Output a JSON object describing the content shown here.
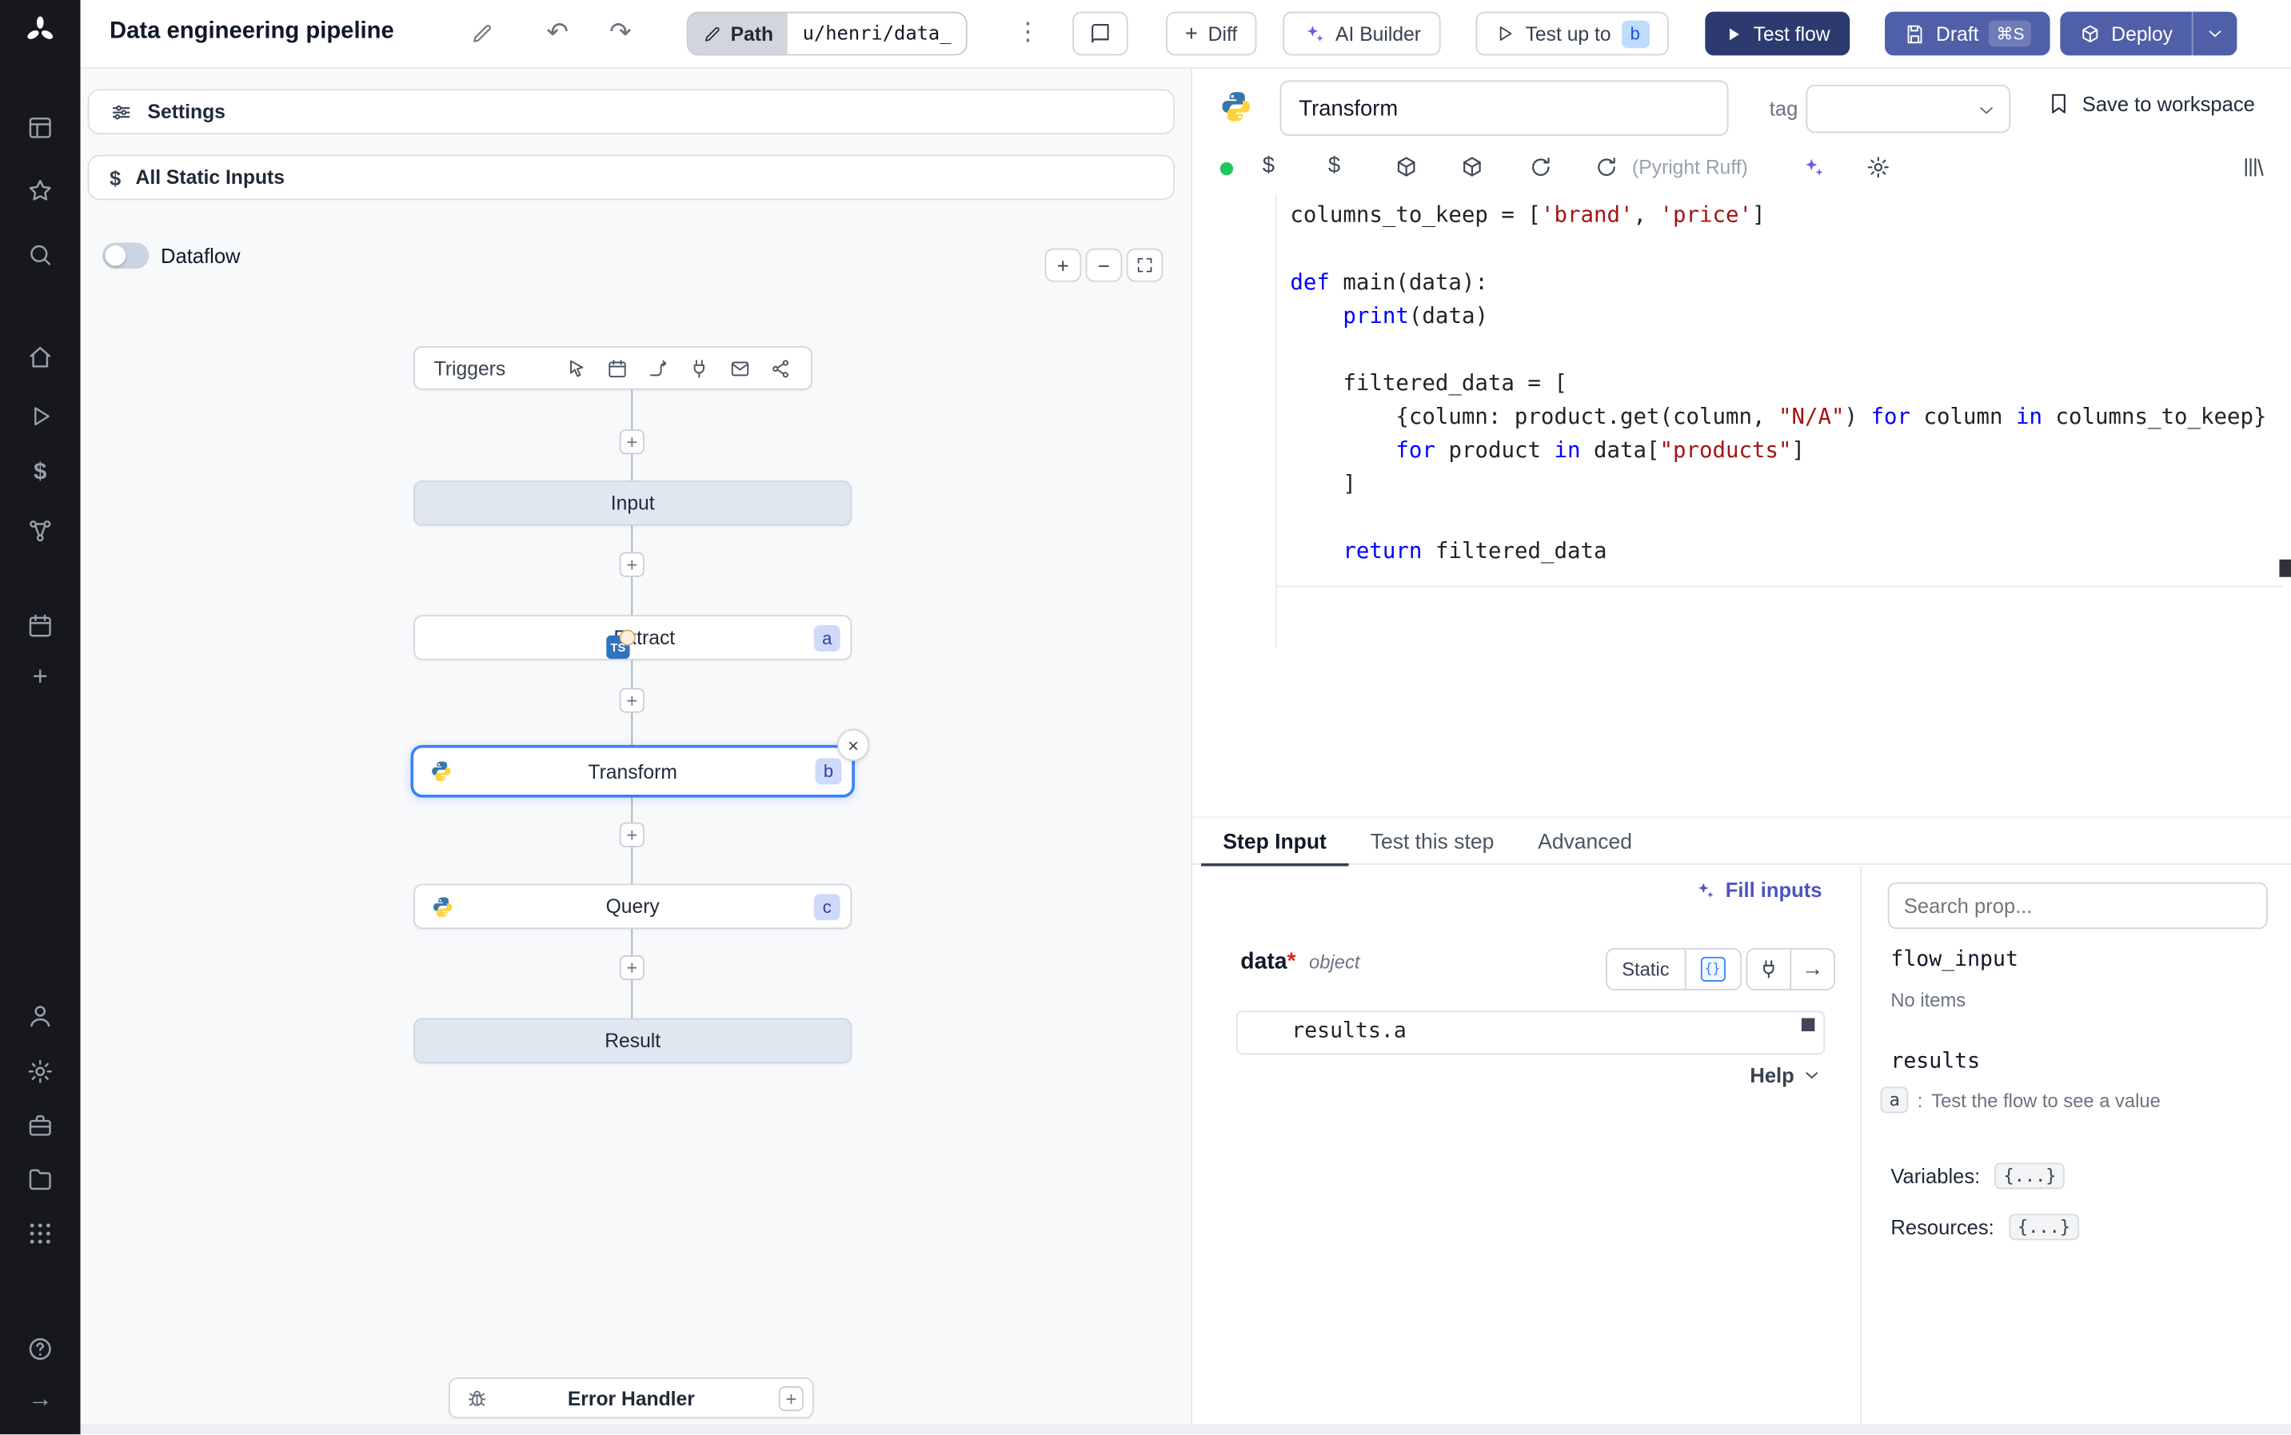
{
  "topbar": {
    "title": "Data engineering pipeline",
    "path_label": "Path",
    "path_value": "u/henri/data_",
    "diff_label": "Diff",
    "ai_builder_label": "AI Builder",
    "test_up_to_label": "Test up to",
    "test_up_to_badge": "b",
    "test_flow_label": "Test flow",
    "draft_label": "Draft",
    "draft_shortcut": "⌘S",
    "deploy_label": "Deploy"
  },
  "icons": {
    "plus": "+",
    "minus": "−",
    "dollar": "$",
    "kebab": "⋮",
    "close": "×",
    "undo": "↶",
    "redo": "↷",
    "arrow_right": "→",
    "braces": "{}",
    "colon": ":"
  },
  "flow": {
    "settings_label": "Settings",
    "static_inputs_label": "All Static Inputs",
    "dataflow_label": "Dataflow",
    "triggers_label": "Triggers",
    "nodes": {
      "input": "Input",
      "extract": {
        "label": "Extract",
        "badge": "a",
        "lang": "TS"
      },
      "transform": {
        "label": "Transform",
        "badge": "b"
      },
      "query": {
        "label": "Query",
        "badge": "c"
      },
      "result": "Result",
      "error_handler": "Error Handler"
    }
  },
  "editor": {
    "step_name": "Transform",
    "tag_label": "tag",
    "save_label": "Save to workspace",
    "diagnostics_label": "(Pyright Ruff)",
    "code_lines": [
      [
        {
          "s": "t",
          "t": "columns_to_keep = ["
        },
        {
          "s": "str",
          "t": "'brand'"
        },
        {
          "s": "t",
          "t": ", "
        },
        {
          "s": "str",
          "t": "'price'"
        },
        {
          "s": "t",
          "t": "]"
        }
      ],
      [],
      [
        {
          "s": "kw",
          "t": "def"
        },
        {
          "s": "t",
          "t": " main(data):"
        }
      ],
      [
        {
          "s": "t",
          "t": "    "
        },
        {
          "s": "kw",
          "t": "print"
        },
        {
          "s": "t",
          "t": "(data)"
        }
      ],
      [],
      [
        {
          "s": "t",
          "t": "    filtered_data = ["
        }
      ],
      [
        {
          "s": "t",
          "t": "        {column: product.get(column, "
        },
        {
          "s": "str",
          "t": "\"N/A\""
        },
        {
          "s": "t",
          "t": ") "
        },
        {
          "s": "kw",
          "t": "for"
        },
        {
          "s": "t",
          "t": " column "
        },
        {
          "s": "kw",
          "t": "in"
        },
        {
          "s": "t",
          "t": " columns_to_keep}"
        }
      ],
      [
        {
          "s": "t",
          "t": "        "
        },
        {
          "s": "kw",
          "t": "for"
        },
        {
          "s": "t",
          "t": " product "
        },
        {
          "s": "kw",
          "t": "in"
        },
        {
          "s": "t",
          "t": " data["
        },
        {
          "s": "str",
          "t": "\"products\""
        },
        {
          "s": "t",
          "t": "]"
        }
      ],
      [
        {
          "s": "t",
          "t": "    ]"
        }
      ],
      [],
      [
        {
          "s": "t",
          "t": "    "
        },
        {
          "s": "kw",
          "t": "return"
        },
        {
          "s": "t",
          "t": " filtered_data"
        }
      ]
    ]
  },
  "step_panel": {
    "tabs": [
      "Step Input",
      "Test this step",
      "Advanced"
    ],
    "fill_inputs_label": "Fill inputs",
    "arg": {
      "name": "data",
      "required": "*",
      "type": "object"
    },
    "static_label": "Static",
    "expr_value": "results.a",
    "help_label": "Help"
  },
  "props": {
    "search_placeholder": "Search prop...",
    "flow_input_label": "flow_input",
    "flow_input_empty": "No items",
    "results_label": "results",
    "result_key": "a",
    "result_hint": "Test the flow to see a value",
    "variables_label": "Variables:",
    "variables_value": "{...}",
    "resources_label": "Resources:",
    "resources_value": "{...}"
  }
}
